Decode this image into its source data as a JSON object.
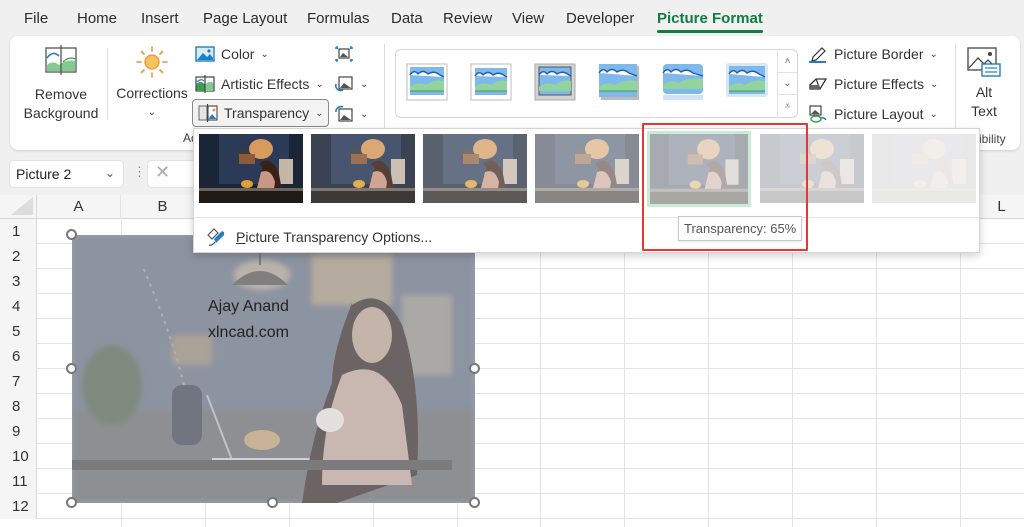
{
  "menubar": {
    "tabs": [
      {
        "label": "File"
      },
      {
        "label": "Home"
      },
      {
        "label": "Insert"
      },
      {
        "label": "Page Layout"
      },
      {
        "label": "Formulas"
      },
      {
        "label": "Data"
      },
      {
        "label": "Review"
      },
      {
        "label": "View"
      },
      {
        "label": "Developer"
      },
      {
        "label": "Picture Format",
        "active": true
      }
    ]
  },
  "ribbon": {
    "adjust": {
      "remove_background": {
        "line1": "Remove",
        "line2": "Background"
      },
      "corrections": {
        "label": "Corrections"
      },
      "color": {
        "label": "Color"
      },
      "artistic_effects": {
        "label": "Artistic Effects"
      },
      "transparency": {
        "label": "Transparency"
      },
      "group_label_fragment": "Ad"
    },
    "picture_styles": {
      "gallery_count": 6,
      "picture_border": {
        "label": "Picture Border"
      },
      "picture_effects": {
        "label": "Picture Effects"
      },
      "picture_layout": {
        "label": "Picture Layout"
      }
    },
    "accessibility": {
      "alt_text": {
        "line1": "Alt",
        "line2": "Text"
      },
      "group_label_fragment": "sibility"
    }
  },
  "formula_bar": {
    "name_box": "Picture 2",
    "cancel_symbol": "✕"
  },
  "sheet": {
    "columns": [
      "A",
      "B",
      "L"
    ],
    "rows": [
      "1",
      "2",
      "3",
      "4",
      "5",
      "6",
      "7",
      "8",
      "9",
      "10",
      "11",
      "12"
    ],
    "picture": {
      "line1": "Ajay Anand",
      "line2": "xlncad.com"
    }
  },
  "transparency_menu": {
    "presets": [
      {
        "transparency_pct": 0
      },
      {
        "transparency_pct": 15
      },
      {
        "transparency_pct": 30
      },
      {
        "transparency_pct": 50
      },
      {
        "transparency_pct": 65,
        "hovered": true
      },
      {
        "transparency_pct": 80
      },
      {
        "transparency_pct": 95
      }
    ],
    "options_label_first": "P",
    "options_label_rest": "icture Transparency Options...",
    "tooltip": "Transparency: 65%"
  },
  "colors": {
    "accent": "#107c41",
    "annotation": "#e53935",
    "hover_fill": "#c9ecd5"
  }
}
